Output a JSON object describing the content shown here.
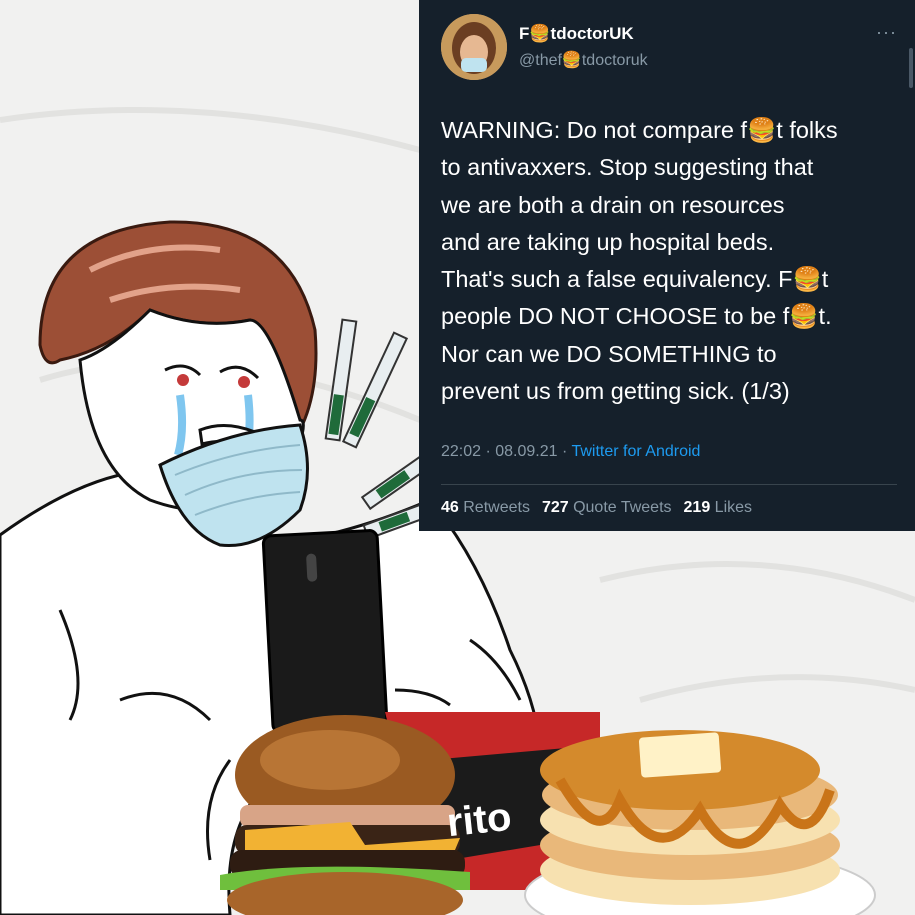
{
  "tweet": {
    "display_name": "F🍔tdoctorUK",
    "handle": "@thef🍔tdoctoruk",
    "more_icon": "more-dots-icon",
    "lines": [
      "WARNING: Do not compare f🍔t folks",
      "to antivaxxers. Stop suggesting that",
      "we are both a drain on resources",
      "and are taking up hospital beds.",
      "That's such a false equivalency. F🍔t",
      "people DO NOT CHOOSE to be f🍔t.",
      "Nor can we DO SOMETHING to",
      "prevent us from getting sick. (1/3)"
    ],
    "time": "22:02 · 08.09.21 · ",
    "source": "Twitter for Android",
    "retweets_count": "46",
    "retweets_label": " Retweets",
    "quote_count": "727",
    "quote_label": " Quote Tweets",
    "likes_count": "219",
    "likes_label": " Likes"
  },
  "meme": {
    "chip_bag_brand": "rito"
  },
  "colors": {
    "tweet_bg": "#15202b",
    "tweet_text": "#ffffff",
    "muted": "#8899a6",
    "link": "#1d9bf0",
    "background": "#f1f1f0"
  }
}
